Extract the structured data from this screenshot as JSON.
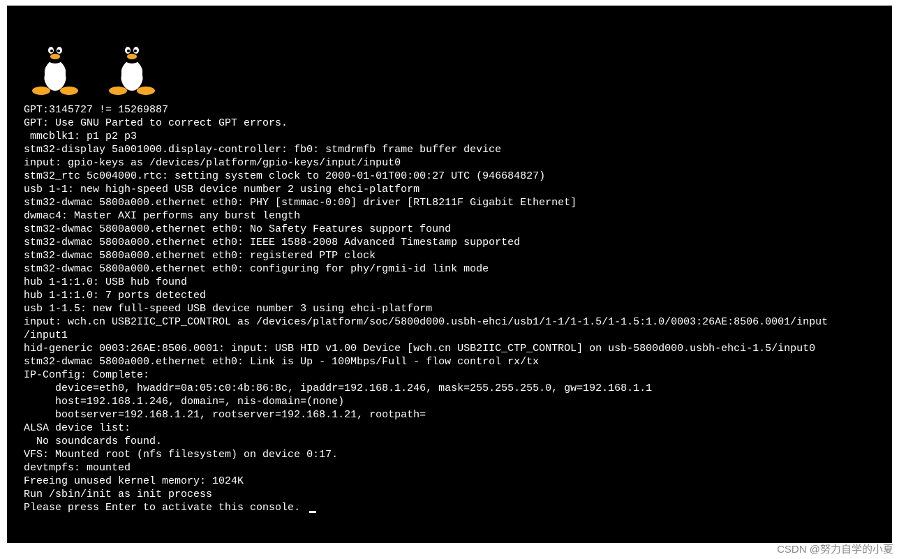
{
  "terminal": {
    "lines": [
      "GPT:3145727 != 15269887",
      "GPT: Use GNU Parted to correct GPT errors.",
      " mmcblk1: p1 p2 p3",
      "stm32-display 5a001000.display-controller: fb0: stmdrmfb frame buffer device",
      "input: gpio-keys as /devices/platform/gpio-keys/input/input0",
      "stm32_rtc 5c004000.rtc: setting system clock to 2000-01-01T00:00:27 UTC (946684827)",
      "usb 1-1: new high-speed USB device number 2 using ehci-platform",
      "stm32-dwmac 5800a000.ethernet eth0: PHY [stmmac-0:00] driver [RTL8211F Gigabit Ethernet]",
      "dwmac4: Master AXI performs any burst length",
      "stm32-dwmac 5800a000.ethernet eth0: No Safety Features support found",
      "stm32-dwmac 5800a000.ethernet eth0: IEEE 1588-2008 Advanced Timestamp supported",
      "stm32-dwmac 5800a000.ethernet eth0: registered PTP clock",
      "stm32-dwmac 5800a000.ethernet eth0: configuring for phy/rgmii-id link mode",
      "hub 1-1:1.0: USB hub found",
      "hub 1-1:1.0: 7 ports detected",
      "usb 1-1.5: new full-speed USB device number 3 using ehci-platform",
      "input: wch.cn USB2IIC_CTP_CONTROL as /devices/platform/soc/5800d000.usbh-ehci/usb1/1-1/1-1.5/1-1.5:1.0/0003:26AE:8506.0001/input",
      "/input1",
      "hid-generic 0003:26AE:8506.0001: input: USB HID v1.00 Device [wch.cn USB2IIC_CTP_CONTROL] on usb-5800d000.usbh-ehci-1.5/input0",
      "stm32-dwmac 5800a000.ethernet eth0: Link is Up - 100Mbps/Full - flow control rx/tx",
      "IP-Config: Complete:",
      "     device=eth0, hwaddr=0a:05:c0:4b:86:8c, ipaddr=192.168.1.246, mask=255.255.255.0, gw=192.168.1.1",
      "     host=192.168.1.246, domain=, nis-domain=(none)",
      "     bootserver=192.168.1.21, rootserver=192.168.1.21, rootpath=",
      "ALSA device list:",
      "  No soundcards found.",
      "VFS: Mounted root (nfs filesystem) on device 0:17.",
      "devtmpfs: mounted",
      "Freeing unused kernel memory: 1024K",
      "Run /sbin/init as init process",
      "",
      "Please press Enter to activate this console. "
    ]
  },
  "watermark": "CSDN @努力自学的小夏"
}
